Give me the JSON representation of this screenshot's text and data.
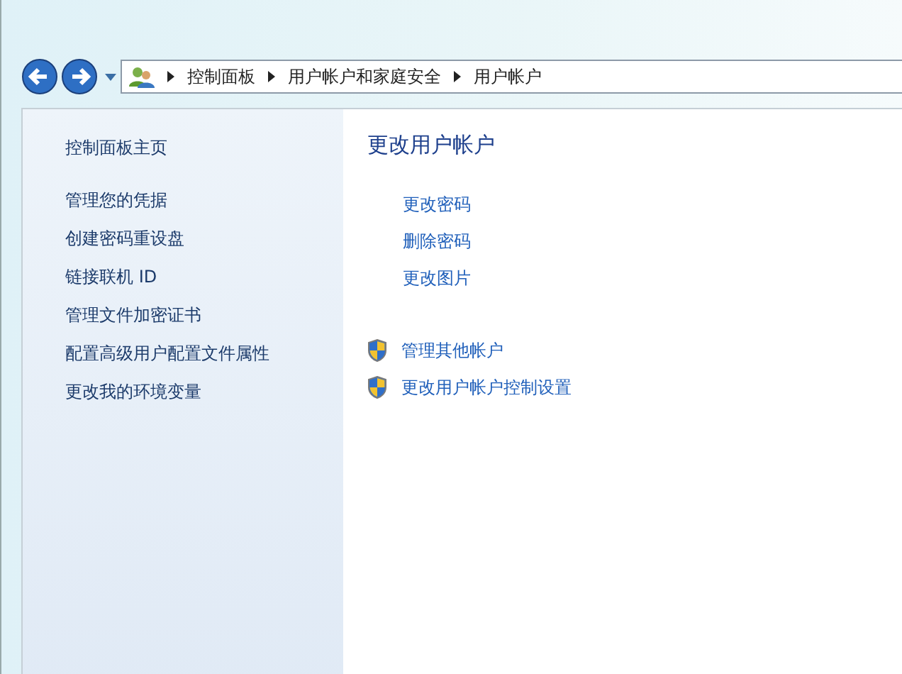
{
  "address_bar": {
    "breadcrumbs": [
      "控制面板",
      "用户帐户和家庭安全",
      "用户帐户"
    ]
  },
  "sidebar": {
    "home": "控制面板主页",
    "items": [
      "管理您的凭据",
      "创建密码重设盘",
      "链接联机 ID",
      "管理文件加密证书",
      "配置高级用户配置文件属性",
      "更改我的环境变量"
    ]
  },
  "main": {
    "title": "更改用户帐户",
    "links": [
      "更改密码",
      "删除密码",
      "更改图片"
    ],
    "admin_links": [
      "管理其他帐户",
      "更改用户帐户控制设置"
    ]
  }
}
